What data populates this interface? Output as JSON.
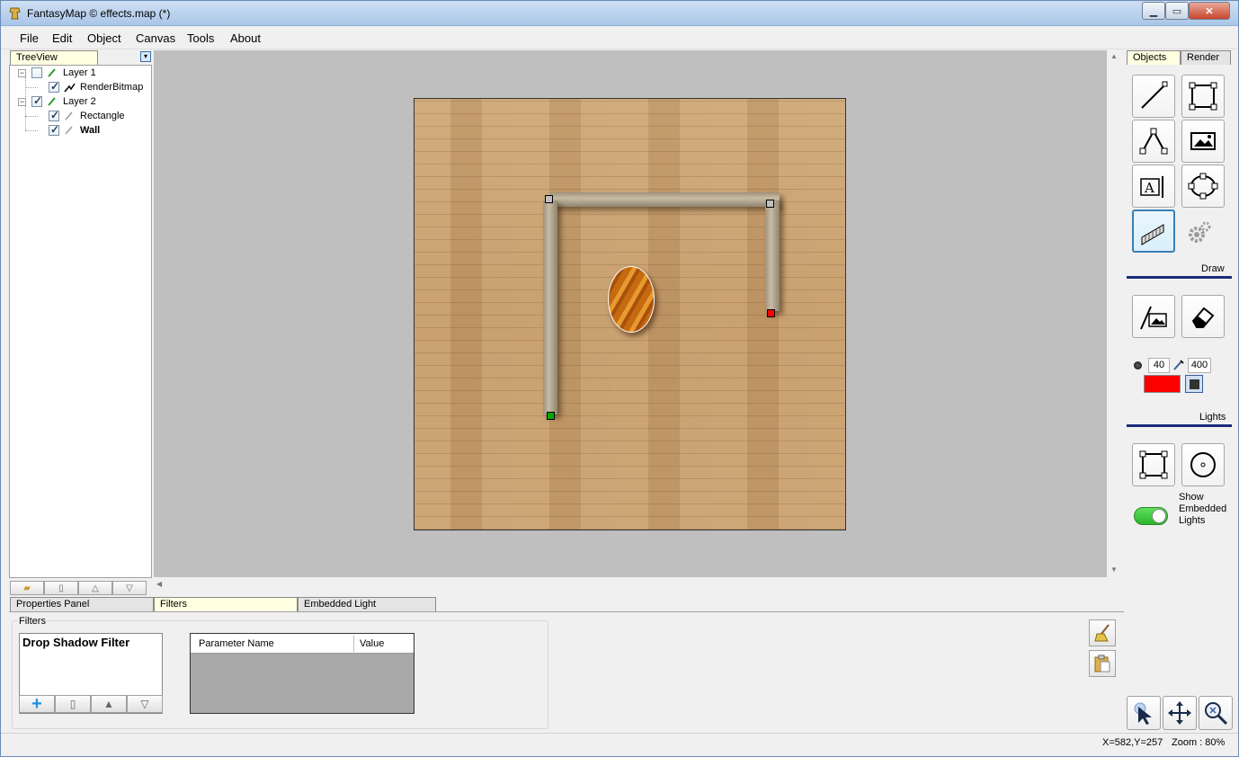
{
  "window": {
    "title": "FantasyMap © effects.map (*)"
  },
  "menu": [
    "File",
    "Edit",
    "Object",
    "Canvas",
    "Tools",
    "About"
  ],
  "tree": {
    "tab_label": "TreeView",
    "items": [
      {
        "label": "Layer 1",
        "checked": false,
        "level": 0
      },
      {
        "label": "RenderBitmap",
        "checked": true,
        "level": 1
      },
      {
        "label": "Layer 2",
        "checked": true,
        "level": 0
      },
      {
        "label": "Rectangle",
        "checked": true,
        "level": 1
      },
      {
        "label": "Wall",
        "checked": true,
        "level": 1,
        "bold": true
      }
    ]
  },
  "right_panel": {
    "tabs": [
      "Objects",
      "Render"
    ],
    "sections": {
      "draw": "Draw",
      "lights": "Lights"
    },
    "brush": {
      "size": "40",
      "strength": "400",
      "color": "#ff0000"
    },
    "show_embedded_lights": "Show Embedded Lights",
    "show_embedded_lights_on": true
  },
  "bottom_tabs": [
    "Properties Panel",
    "Filters",
    "Embedded Light"
  ],
  "filters": {
    "group_label": "Filters",
    "items": [
      "Drop Shadow Filter"
    ],
    "grid_columns": [
      "Parameter Name",
      "Value"
    ]
  },
  "status": {
    "coords": "X=582,Y=257",
    "zoom": "Zoom : 80%"
  },
  "colors": {
    "handle_start": "#00aa00",
    "handle_end": "#ff0000",
    "handle_mid": "#c0c0c0",
    "accent": "#1a2a7a"
  }
}
